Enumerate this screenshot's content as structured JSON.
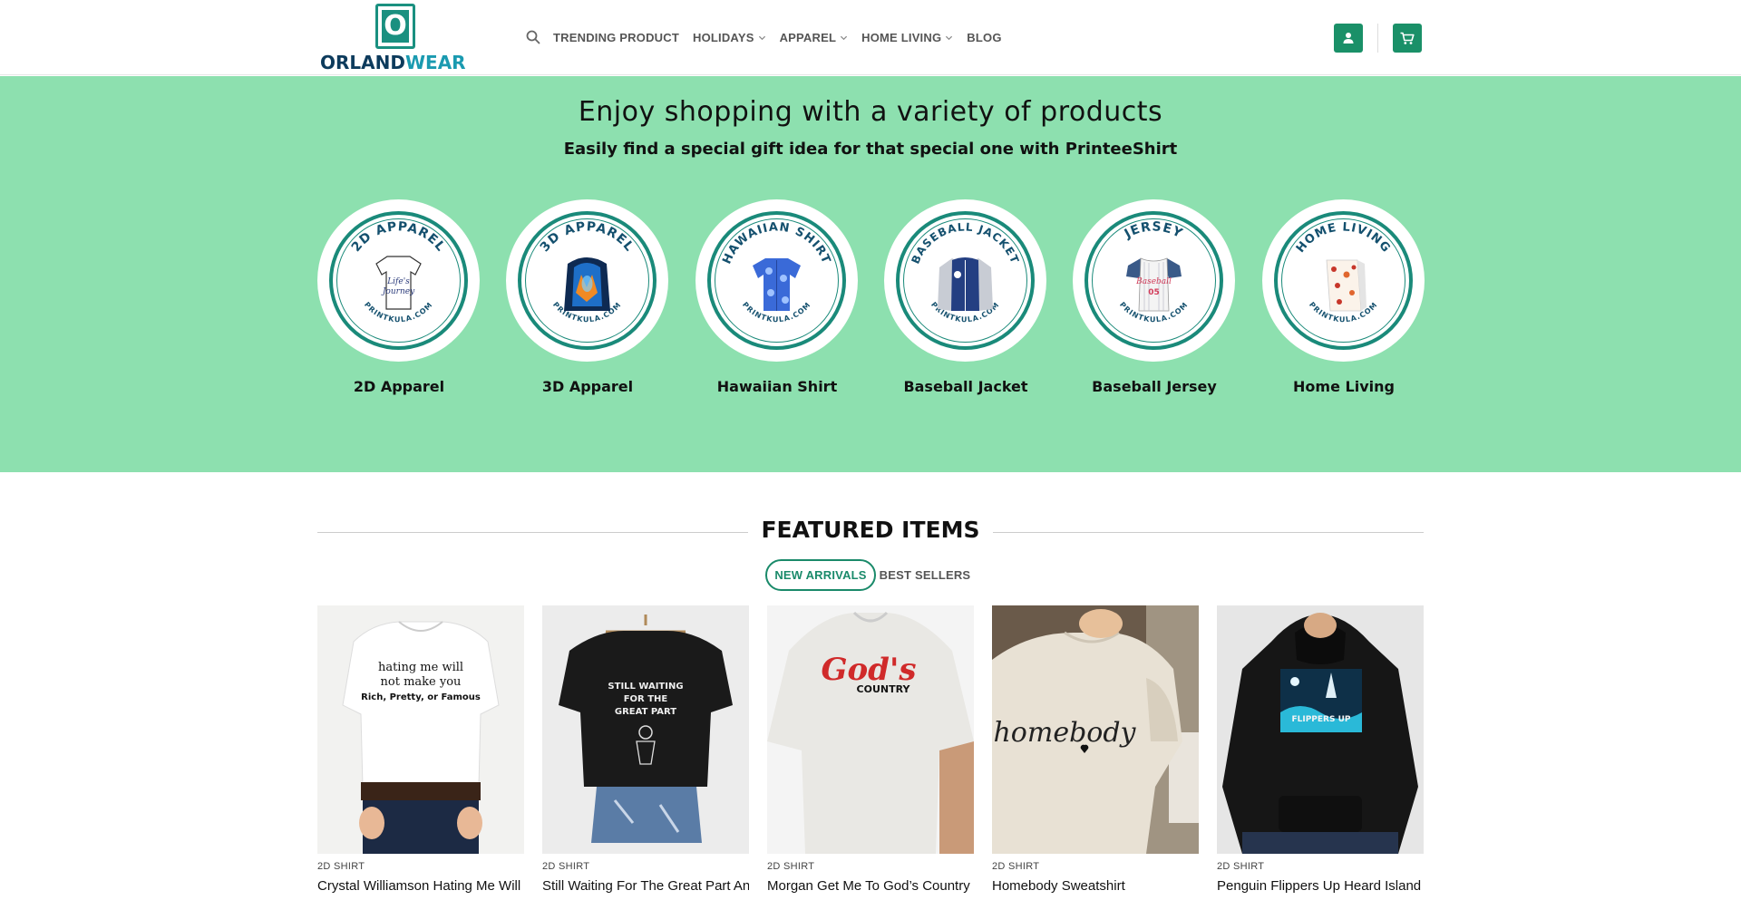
{
  "header": {
    "logo_letter": "O",
    "logo_text_part1": "ORLAND",
    "logo_text_part2": "WEAR",
    "nav": [
      {
        "label": "TRENDING PRODUCT",
        "dropdown": false
      },
      {
        "label": "HOLIDAYS",
        "dropdown": true
      },
      {
        "label": "APPAREL",
        "dropdown": true
      },
      {
        "label": "HOME LIVING",
        "dropdown": true
      },
      {
        "label": "BLOG",
        "dropdown": false
      }
    ],
    "icons": {
      "search": "search-icon",
      "account": "user-icon",
      "cart": "cart-icon"
    },
    "accent_color": "#1a9068"
  },
  "hero": {
    "title": "Enjoy shopping with a variety of products",
    "subtitle": "Easily find a special gift idea for that special one with PrinteeShirt",
    "background": "#8de0af",
    "categories": [
      {
        "badge_text": "2D APPAREL",
        "site": "PRINTKULA.COM",
        "label": "2D Apparel"
      },
      {
        "badge_text": "3D APPAREL",
        "site": "PRINTKULA.COM",
        "label": "3D Apparel"
      },
      {
        "badge_text": "HAWAIIAN SHIRT",
        "site": "PRINTKULA.COM",
        "label": "Hawaiian Shirt"
      },
      {
        "badge_text": "BASEBALL JACKET",
        "site": "PRINTKULA.COM",
        "label": "Baseball Jacket"
      },
      {
        "badge_text": "JERSEY",
        "site": "PRINTKULA.COM",
        "label": "Baseball Jersey"
      },
      {
        "badge_text": "HOME LIVING",
        "site": "PRINTKULA.COM",
        "label": "Home Living"
      }
    ]
  },
  "featured": {
    "title": "FEATURED ITEMS",
    "tabs": [
      {
        "label": "NEW ARRIVALS",
        "active": true
      },
      {
        "label": "BEST SELLERS",
        "active": false
      }
    ],
    "products": [
      {
        "category": "2D SHIRT",
        "name": "Crystal Williamson Hating Me Will Not Make You Rich, Pretty, Or Famous",
        "print_text": [
          "hating me will",
          "not make you",
          "Rich, Pretty, or Famous"
        ]
      },
      {
        "category": "2D SHIRT",
        "name": "Still Waiting For The Great Part Anti MAGA Shirt",
        "print_text": [
          "STILL WAITING",
          "FOR THE",
          "GREAT PART"
        ]
      },
      {
        "category": "2D SHIRT",
        "name": "Morgan Get Me To God’s Country Shirt",
        "print_text": [
          "God's",
          "COUNTRY"
        ]
      },
      {
        "category": "2D SHIRT",
        "name": "Homebody Sweatshirt",
        "print_text": [
          "homebody"
        ]
      },
      {
        "category": "2D SHIRT",
        "name": "Penguin Flippers Up Heard Island Shirt",
        "print_text": [
          "FLIPPERS UP"
        ]
      }
    ]
  }
}
